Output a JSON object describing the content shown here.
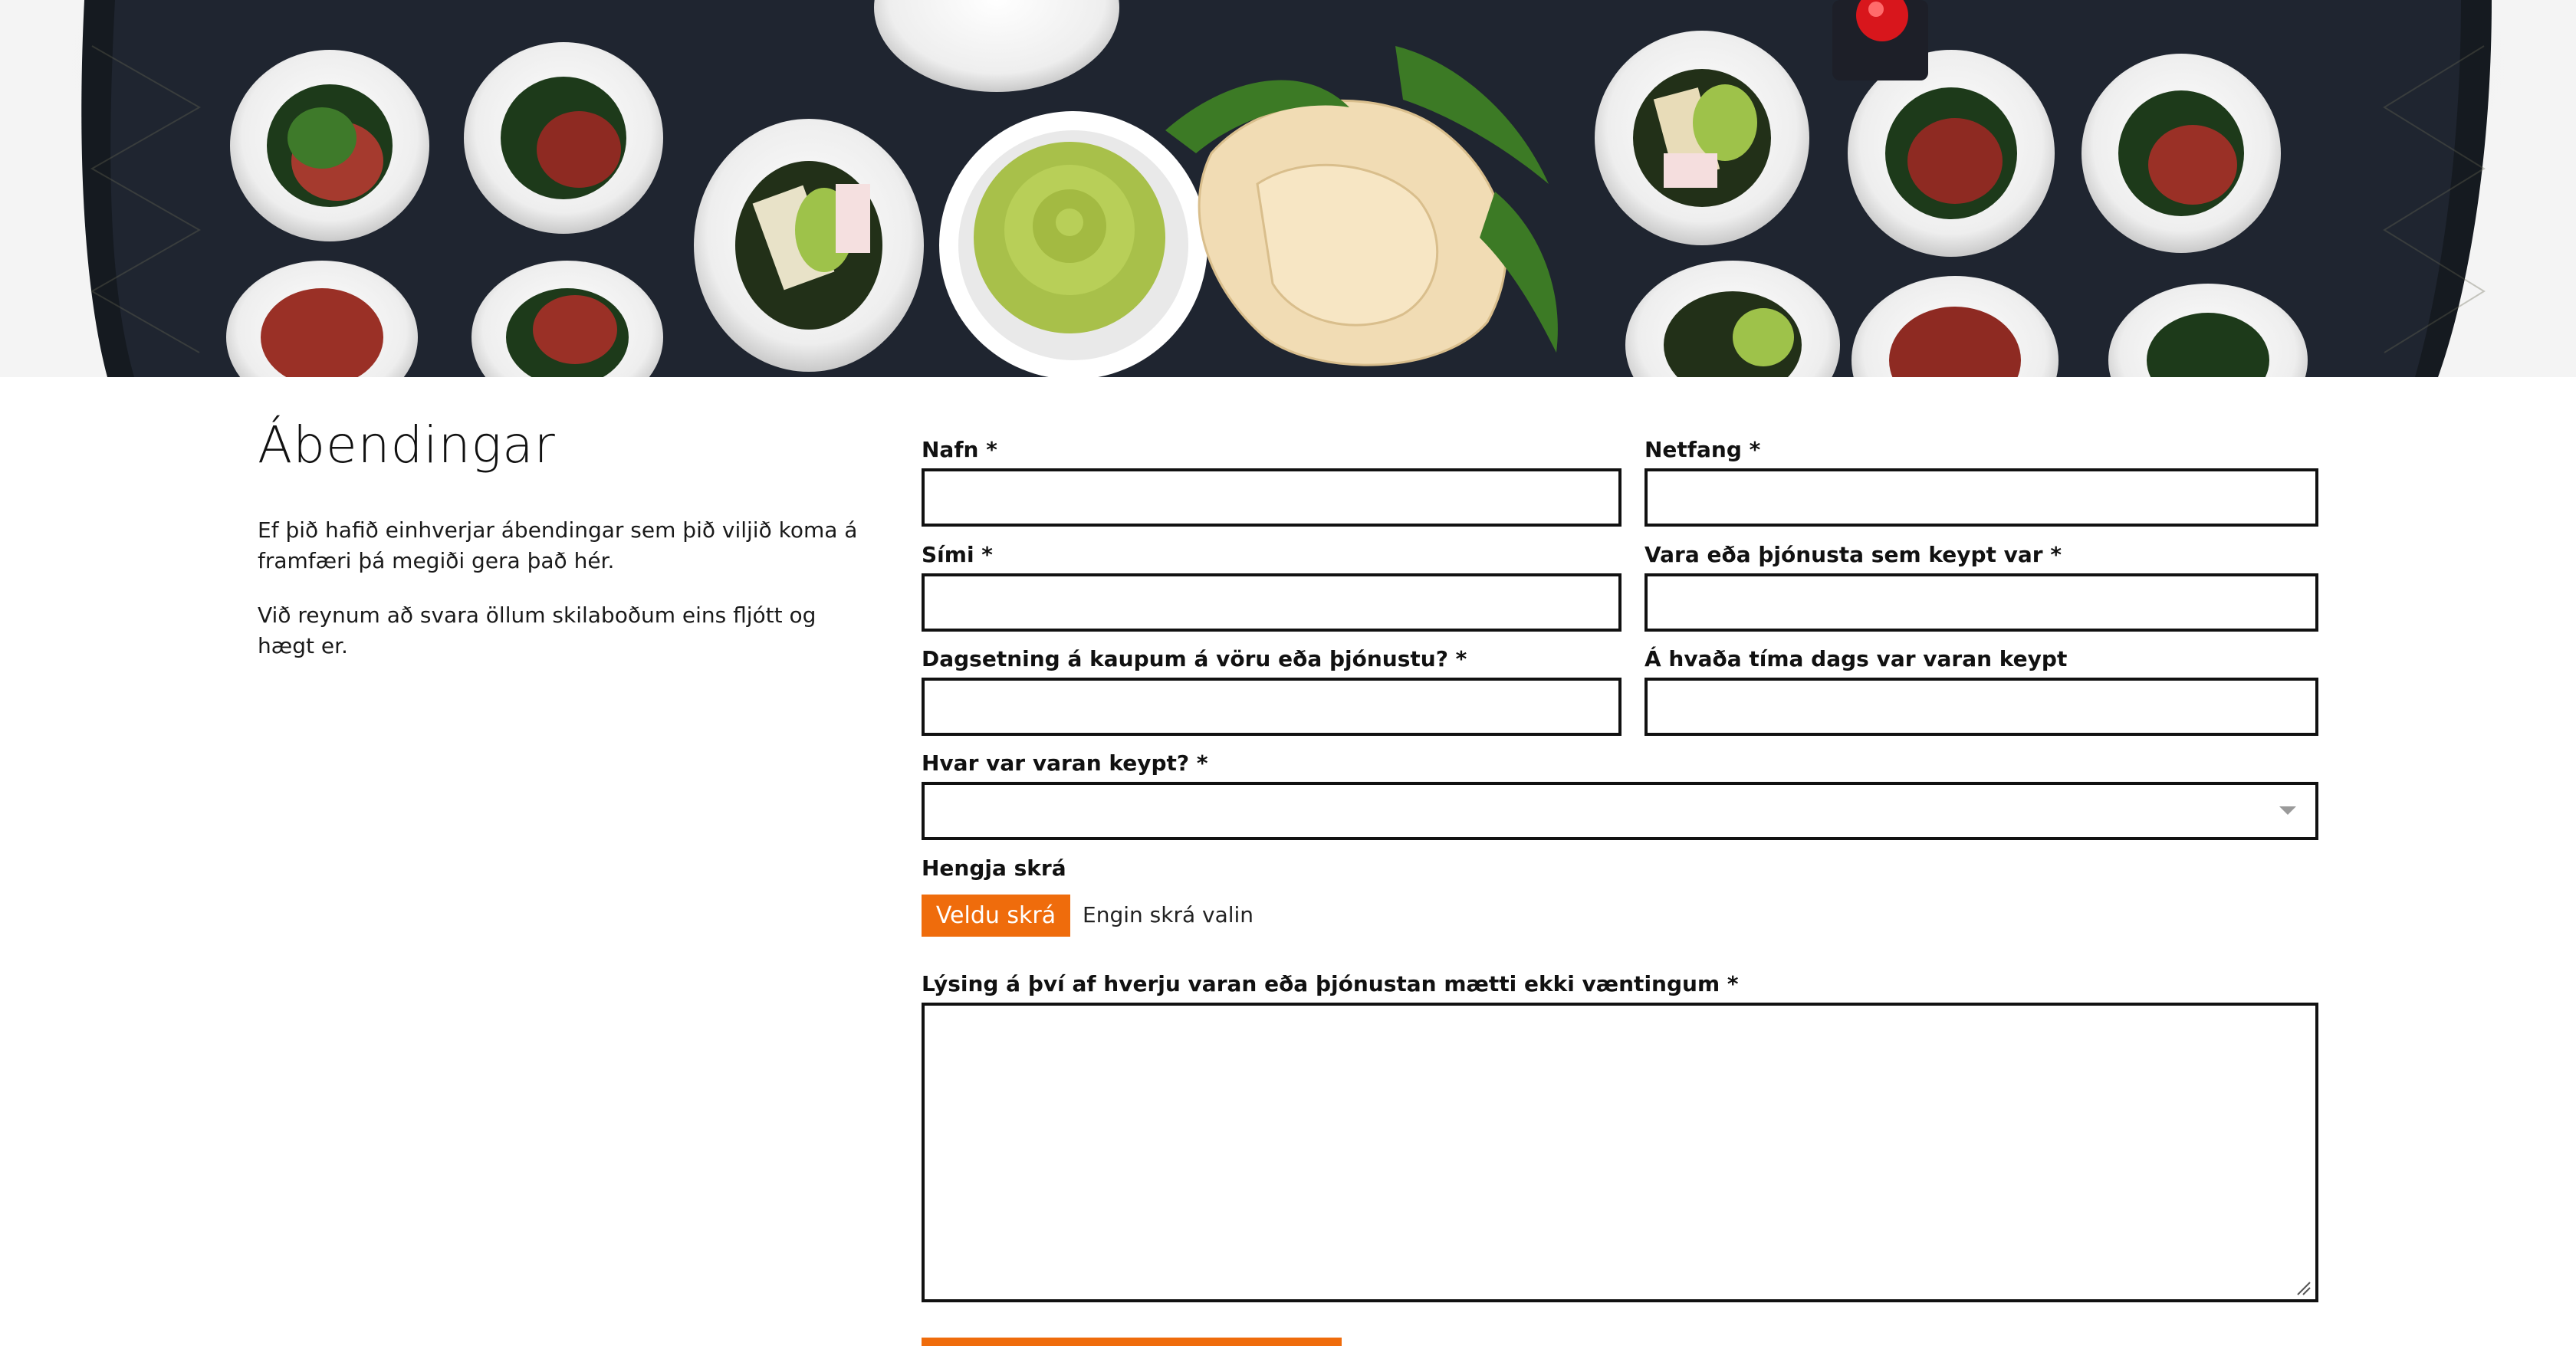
{
  "hero": {
    "image_icon": "sushi-platter-photo"
  },
  "intro": {
    "title": "Ábendingar",
    "paragraph_1": "Ef þið hafið einhverjar ábendingar sem þið viljið koma á framfæri þá megiði gera það hér.",
    "paragraph_2": "Við reynum að svara öllum skilaboðum eins fljótt og hægt er."
  },
  "form": {
    "name_label": "Nafn *",
    "name_value": "",
    "email_label": "Netfang *",
    "email_value": "",
    "phone_label": "Sími *",
    "phone_value": "",
    "product_label": "Vara eða þjónusta sem keypt var *",
    "product_value": "",
    "date_label": "Dagsetning á kaupum á vöru eða þjónustu? *",
    "date_value": "",
    "time_label": "Á hvaða tíma dags var varan keypt",
    "time_value": "",
    "location_label": "Hvar var varan keypt? *",
    "location_selected": "",
    "attach_label": "Hengja skrá",
    "file_button_label": "Veldu skrá",
    "file_status": "Engin skrá valin",
    "description_label": "Lýsing á því af hverju varan eða þjónustan mætti ekki væntingum *",
    "description_value": ""
  },
  "colors": {
    "accent": "#ef6c0c",
    "border": "#111111",
    "text": "#111111"
  }
}
